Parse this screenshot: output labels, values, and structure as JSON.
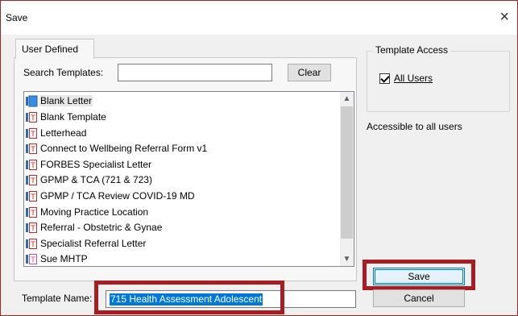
{
  "window": {
    "title": "Save",
    "close_glyph": "×"
  },
  "tabs": [
    {
      "label": "User Defined",
      "active": true
    }
  ],
  "search": {
    "label": "Search Templates:",
    "value": "",
    "clear_label": "Clear"
  },
  "templates": [
    {
      "label": "Blank Letter",
      "icon": "blue-document-icon",
      "selected": true
    },
    {
      "label": "Blank Template",
      "icon": "template-document-icon"
    },
    {
      "label": "Letterhead",
      "icon": "letterhead-document-icon"
    },
    {
      "label": "Connect to Wellbeing Referral Form v1",
      "icon": "template-document-icon"
    },
    {
      "label": "FORBES Specialist Letter",
      "icon": "template-document-icon"
    },
    {
      "label": "GPMP & TCA (721 & 723)",
      "icon": "template-document-icon"
    },
    {
      "label": "GPMP / TCA Review COVID-19 MD",
      "icon": "template-document-icon"
    },
    {
      "label": "Moving Practice Location",
      "icon": "template-document-icon"
    },
    {
      "label": "Referral - Obstetric & Gynae",
      "icon": "template-document-icon"
    },
    {
      "label": "Specialist Referral Letter",
      "icon": "template-document-icon"
    },
    {
      "label": "Sue MHTP",
      "icon": "mh-template-document-icon"
    }
  ],
  "access": {
    "legend": "Template Access",
    "all_users_label": "All Users",
    "all_users_checked": true,
    "description": "Accessible to all users"
  },
  "template_name": {
    "label": "Template Name:",
    "value": "715 Health Assessment Adolescent"
  },
  "buttons": {
    "save": "Save",
    "cancel": "Cancel"
  },
  "colors": {
    "highlight": "#a61e22",
    "selection": "#0078d7",
    "accent": "#0078d7"
  }
}
